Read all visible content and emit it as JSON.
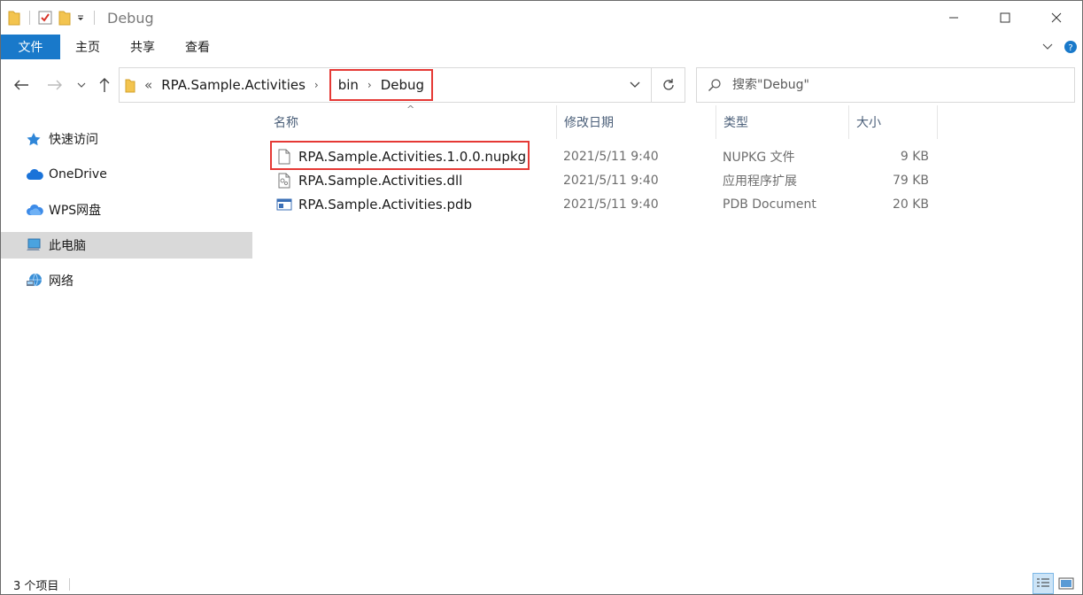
{
  "window": {
    "title": "Debug"
  },
  "ribbon": {
    "tabs": [
      "文件",
      "主页",
      "共享",
      "查看"
    ]
  },
  "address": {
    "overflow": "«",
    "crumbs": [
      "RPA.Sample.Activities",
      "bin",
      "Debug"
    ]
  },
  "search": {
    "placeholder": "搜索\"Debug\""
  },
  "sidebar": {
    "items": [
      {
        "label": "快速访问",
        "icon": "star-icon"
      },
      {
        "label": "OneDrive",
        "icon": "cloud-icon"
      },
      {
        "label": "WPS网盘",
        "icon": "wps-cloud-icon"
      },
      {
        "label": "此电脑",
        "icon": "computer-icon",
        "selected": true
      },
      {
        "label": "网络",
        "icon": "network-icon"
      }
    ]
  },
  "columns": {
    "name": "名称",
    "date": "修改日期",
    "type": "类型",
    "size": "大小"
  },
  "files": [
    {
      "name": "RPA.Sample.Activities.1.0.0.nupkg",
      "date": "2021/5/11 9:40",
      "type": "NUPKG 文件",
      "size": "9 KB",
      "icon": "generic-file-icon"
    },
    {
      "name": "RPA.Sample.Activities.dll",
      "date": "2021/5/11 9:40",
      "type": "应用程序扩展",
      "size": "79 KB",
      "icon": "dll-file-icon"
    },
    {
      "name": "RPA.Sample.Activities.pdb",
      "date": "2021/5/11 9:40",
      "type": "PDB Document",
      "size": "20 KB",
      "icon": "pdb-file-icon"
    }
  ],
  "status": {
    "count": "3 个项目"
  },
  "colors": {
    "accent": "#1979ca",
    "highlight": "#e53935",
    "selected": "#d9d9d9"
  }
}
